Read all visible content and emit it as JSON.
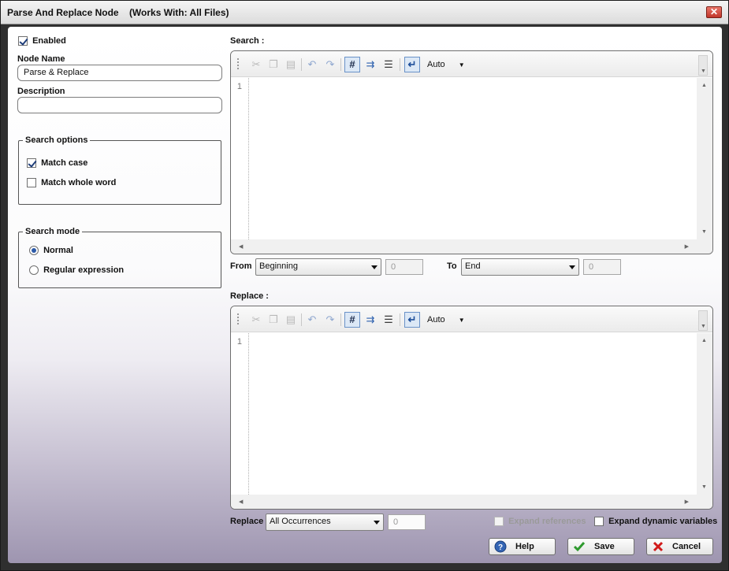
{
  "window": {
    "title": "Parse And Replace Node    (Works With: All Files)",
    "close_glyph": "✕"
  },
  "left": {
    "enabled_label": "Enabled",
    "enabled_checked": true,
    "node_name_label": "Node Name",
    "node_name_value": "Parse & Replace",
    "description_label": "Description",
    "description_value": "",
    "search_options": {
      "legend": "Search options",
      "match_case_label": "Match case",
      "match_case_checked": true,
      "match_whole_word_label": "Match whole word",
      "match_whole_word_checked": false
    },
    "search_mode": {
      "legend": "Search mode",
      "normal_label": "Normal",
      "regex_label": "Regular expression",
      "selected": "Normal"
    }
  },
  "search": {
    "label": "Search :",
    "line_number": "1",
    "auto_label": "Auto",
    "toolbar_icons": [
      "cut-icon",
      "copy-icon",
      "paste-icon",
      "undo-icon",
      "redo-icon",
      "line-numbers-icon",
      "whitespace-icon",
      "formatting-icon",
      "word-wrap-icon"
    ],
    "from_label": "From",
    "from_value": "Beginning",
    "from_number": "0",
    "to_label": "To",
    "to_value": "End",
    "to_number": "0"
  },
  "replace": {
    "label": "Replace :",
    "line_number": "1",
    "auto_label": "Auto",
    "toolbar_icons": [
      "cut-icon",
      "copy-icon",
      "paste-icon",
      "undo-icon",
      "redo-icon",
      "line-numbers-icon",
      "whitespace-icon",
      "formatting-icon",
      "word-wrap-icon"
    ],
    "mode_label": "Replace",
    "mode_value": "All Occurrences",
    "mode_number": "0",
    "expand_references_label": "Expand references",
    "expand_references_enabled": false,
    "expand_dynamic_label": "Expand dynamic variables"
  },
  "buttons": {
    "help": "Help",
    "save": "Save",
    "cancel": "Cancel"
  },
  "colors": {
    "accent": "#2c5aa8",
    "cancel_x": "#d11a1a",
    "save_check": "#2f9a2f"
  }
}
